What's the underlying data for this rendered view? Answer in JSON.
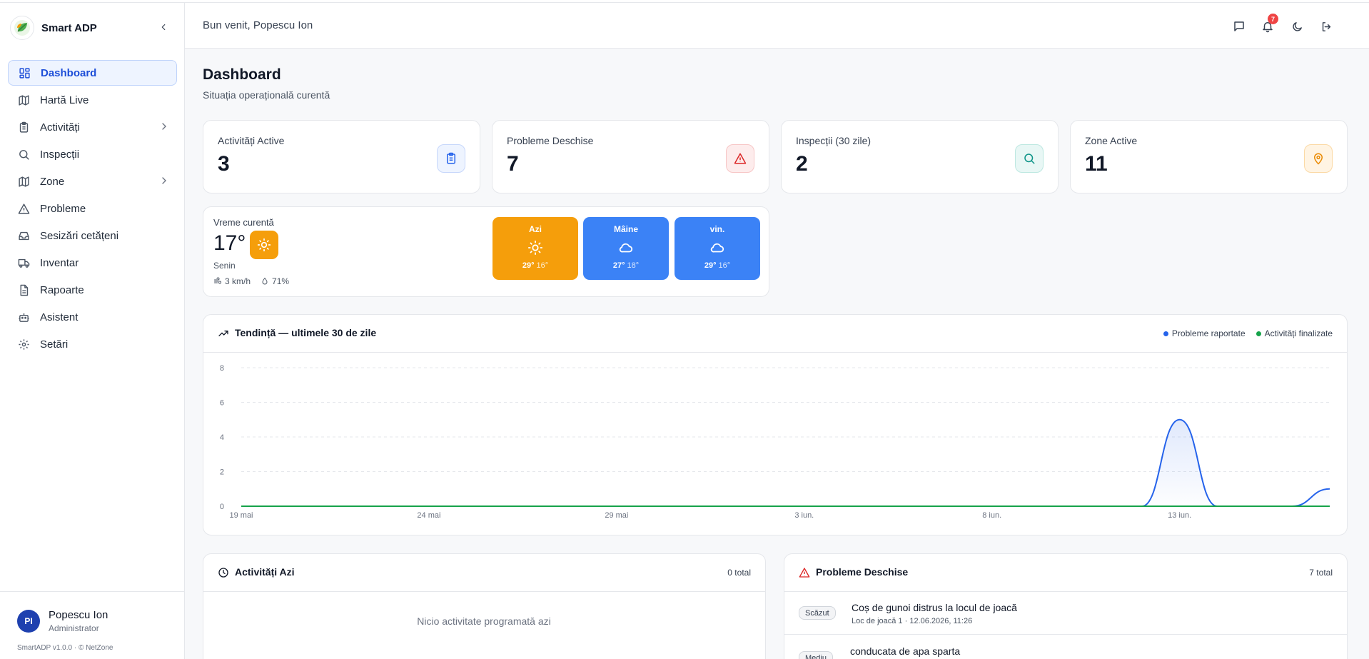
{
  "app": {
    "name": "Smart ADP"
  },
  "header": {
    "welcome": "Bun venit, Popescu Ion",
    "notifications_count": "7"
  },
  "sidebar": {
    "items": [
      {
        "label": "Dashboard",
        "icon": "dashboard-icon",
        "active": true
      },
      {
        "label": "Hartă Live",
        "icon": "map-icon"
      },
      {
        "label": "Activități",
        "icon": "clipboard-icon",
        "has_children": true
      },
      {
        "label": "Inspecții",
        "icon": "search-icon"
      },
      {
        "label": "Zone",
        "icon": "map-icon",
        "has_children": true
      },
      {
        "label": "Probleme",
        "icon": "warning-icon"
      },
      {
        "label": "Sesizări cetățeni",
        "icon": "inbox-icon"
      },
      {
        "label": "Inventar",
        "icon": "truck-icon"
      },
      {
        "label": "Rapoarte",
        "icon": "file-icon"
      },
      {
        "label": "Asistent",
        "icon": "bot-icon"
      },
      {
        "label": "Setări",
        "icon": "gear-icon"
      }
    ],
    "user": {
      "initials": "PI",
      "name": "Popescu Ion",
      "role": "Administrator"
    },
    "version": "SmartADP v1.0.0 · © NetZone"
  },
  "page": {
    "title": "Dashboard",
    "subtitle": "Situația operațională curentă"
  },
  "stats": [
    {
      "label": "Activități Active",
      "value": "3",
      "icon": "clipboard-icon",
      "color": "#2563eb",
      "bg": "#eef4ff"
    },
    {
      "label": "Probleme Deschise",
      "value": "7",
      "icon": "warning-icon",
      "color": "#dc2626",
      "bg": "#fdecec"
    },
    {
      "label": "Inspecții (30 zile)",
      "value": "2",
      "icon": "search-icon",
      "color": "#0d9488",
      "bg": "#e8f7f5"
    },
    {
      "label": "Zone Active",
      "value": "11",
      "icon": "map-pin-icon",
      "color": "#ea8a00",
      "bg": "#fff4e3"
    }
  ],
  "weather": {
    "label": "Vreme curentă",
    "temp": "17°",
    "condition": "Senin",
    "wind": "3 km/h",
    "humidity": "71%",
    "forecast": [
      {
        "day": "Azi",
        "icon": "sun-icon",
        "max": "29°",
        "min": "16°",
        "color": "#f59e0b"
      },
      {
        "day": "Mâine",
        "icon": "cloud-icon",
        "max": "27°",
        "min": "18°",
        "color": "#3b82f6"
      },
      {
        "day": "vin.",
        "icon": "cloud-icon",
        "max": "29°",
        "min": "16°",
        "color": "#3b82f6"
      }
    ]
  },
  "trend": {
    "title": "Tendință — ultimele 30 de zile",
    "legend": [
      {
        "name": "Probleme raportate",
        "color": "#2563eb"
      },
      {
        "name": "Activități finalizate",
        "color": "#16a34a"
      }
    ]
  },
  "chart_data": {
    "type": "area",
    "title": "Tendință — ultimele 30 de zile",
    "x": [
      "19 mai",
      "20 mai",
      "21 mai",
      "22 mai",
      "23 mai",
      "24 mai",
      "25 mai",
      "26 mai",
      "27 mai",
      "28 mai",
      "29 mai",
      "30 mai",
      "31 mai",
      "1 iun.",
      "2 iun.",
      "3 iun.",
      "4 iun.",
      "5 iun.",
      "6 iun.",
      "7 iun.",
      "8 iun.",
      "9 iun.",
      "10 iun.",
      "11 iun.",
      "12 iun.",
      "13 iun.",
      "14 iun.",
      "15 iun.",
      "16 iun.",
      "17 iun."
    ],
    "x_ticks": [
      "19 mai",
      "24 mai",
      "29 mai",
      "3 iun.",
      "8 iun.",
      "13 iun."
    ],
    "y_ticks": [
      0,
      2,
      4,
      6,
      8
    ],
    "ylim": [
      0,
      8
    ],
    "grid": true,
    "legend_position": "top-right",
    "series": [
      {
        "name": "Probleme raportate",
        "color": "#2563eb",
        "values": [
          0,
          0,
          0,
          0,
          0,
          0,
          0,
          0,
          0,
          0,
          0,
          0,
          0,
          0,
          0,
          0,
          0,
          0,
          0,
          0,
          0,
          0,
          0,
          0,
          0,
          5,
          0,
          0,
          0,
          1
        ]
      },
      {
        "name": "Activități finalizate",
        "color": "#16a34a",
        "values": [
          0,
          0,
          0,
          0,
          0,
          0,
          0,
          0,
          0,
          0,
          0,
          0,
          0,
          0,
          0,
          0,
          0,
          0,
          0,
          0,
          0,
          0,
          0,
          0,
          0,
          0,
          0,
          0,
          0,
          0
        ]
      }
    ]
  },
  "activities_today": {
    "title": "Activități Azi",
    "count": "0 total",
    "empty": "Nicio activitate programată azi"
  },
  "open_problems": {
    "title": "Probleme Deschise",
    "count": "7 total",
    "items": [
      {
        "severity": "Scăzut",
        "title": "Coș de gunoi distrus la locul de joacă",
        "meta": "Loc de joacă 1 · 12.06.2026, 11:26"
      },
      {
        "severity": "Mediu",
        "title": "conducata de apa sparta",
        "meta": ""
      }
    ]
  }
}
